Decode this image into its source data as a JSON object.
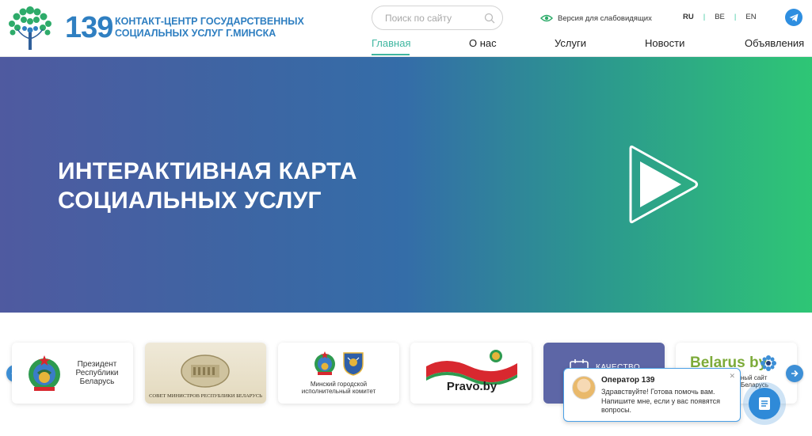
{
  "header": {
    "logo_number": "139",
    "logo_title_line1": "КОНТАКТ-ЦЕНТР ГОСУДАРСТВЕННЫХ",
    "logo_title_line2": "СОЦИАЛЬНЫХ УСЛУГ Г.МИНСКА",
    "search_placeholder": "Поиск по сайту",
    "vision_label": "Версия для слабовидящих",
    "languages": [
      "RU",
      "BE",
      "EN"
    ],
    "active_language": "RU"
  },
  "nav": {
    "items": [
      "Главная",
      "О нас",
      "Услуги",
      "Новости",
      "Объявления"
    ],
    "active": "Главная"
  },
  "hero": {
    "title_line1": "ИНТЕРАКТИВНАЯ КАРТА",
    "title_line2": "СОЦИАЛЬНЫХ УСЛУГ"
  },
  "partners": {
    "cards": [
      {
        "name": "president",
        "text": "Президент Республики Беларусь"
      },
      {
        "name": "council",
        "text": "СОВЕТ МИНИСТРОВ РЕСПУБЛИКИ БЕЛАРУСЬ"
      },
      {
        "name": "minsk",
        "text": "Минский городской исполнительный комитет"
      },
      {
        "name": "pravo",
        "text": "Pravo.by"
      },
      {
        "name": "quality",
        "text": "КАЧЕСТВО"
      },
      {
        "name": "belarus",
        "text": "Belarus by",
        "subtext": "ный сайт Беларусь"
      }
    ]
  },
  "chat": {
    "operator": "Оператор 139",
    "message": "Здравствуйте! Готова помочь вам. Напишите мне, если у вас появятся вопросы."
  },
  "colors": {
    "brand_blue": "#2f7fc1",
    "accent_green": "#3fb6a0",
    "hero_start": "#4f5aa0",
    "hero_end": "#2ec675"
  }
}
